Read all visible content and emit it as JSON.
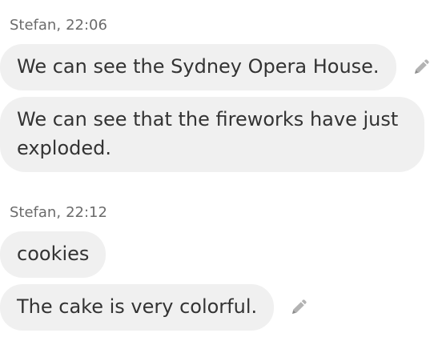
{
  "messages": [
    {
      "sender": "Stefan",
      "time": "22:06",
      "bubbles": [
        {
          "text": "We can see the Sydney Opera House.",
          "editable": true
        },
        {
          "text": "We can see that the fireworks have just exploded.",
          "editable": false
        }
      ]
    },
    {
      "sender": "Stefan",
      "time": "22:12",
      "bubbles": [
        {
          "text": "cookies",
          "editable": false
        },
        {
          "text": "The cake is very colorful.",
          "editable": true
        }
      ]
    }
  ],
  "icons": {
    "edit": "pencil-icon"
  },
  "colors": {
    "bubble_background": "#f0f0f0",
    "message_text": "#333333",
    "sender_text": "#6b6b6b",
    "icon": "#b3b3b3"
  }
}
